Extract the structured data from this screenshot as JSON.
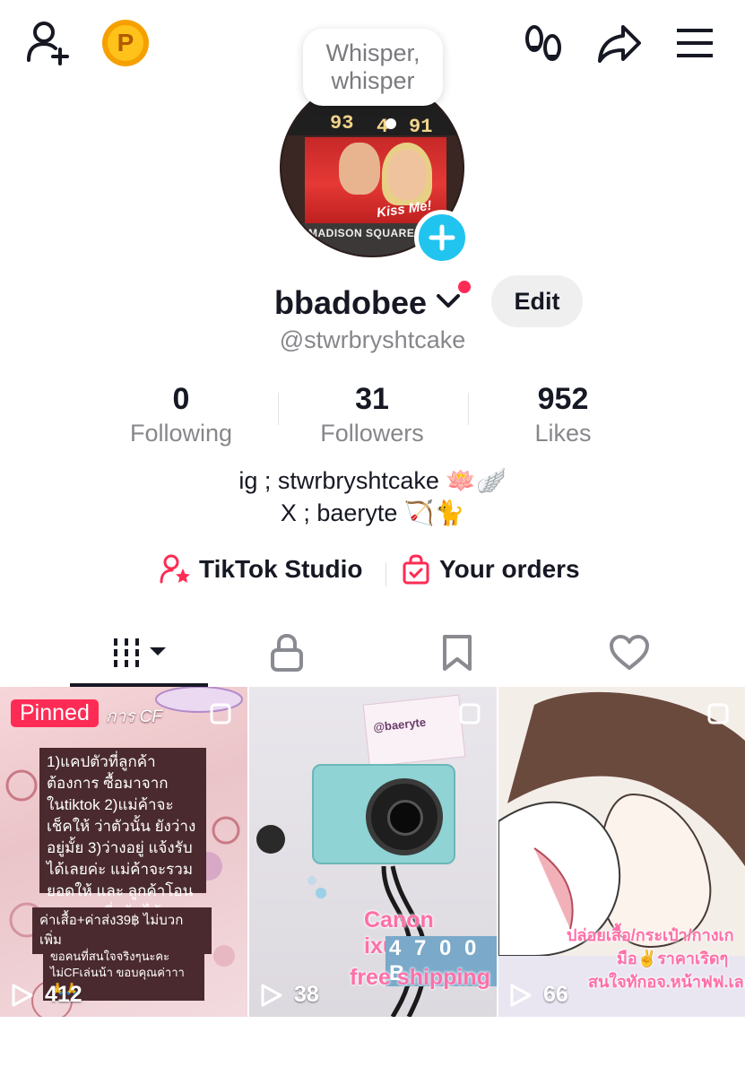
{
  "tooltip": {
    "text_line1": "Whisper,",
    "text_line2": "whisper"
  },
  "avatar": {
    "score_left": "93",
    "score_period": "4",
    "score_right": "91",
    "caption": "Kiss Me!",
    "sign": "MADISON SQUARE GA"
  },
  "profile": {
    "username": "bbadobee",
    "handle": "@stwrbryshtcake",
    "edit_label": "Edit"
  },
  "stats": [
    {
      "value": "0",
      "label": "Following"
    },
    {
      "value": "31",
      "label": "Followers"
    },
    {
      "value": "952",
      "label": "Likes"
    }
  ],
  "bio": {
    "line1": "ig ; stwrbryshtcake 🪷🪽",
    "line2": "X ; baeryte 🏹🐈"
  },
  "links": {
    "studio_label": "TikTok Studio",
    "orders_label": "Your orders"
  },
  "colors": {
    "accent": "#fe2c55",
    "add_button": "#20c4ef",
    "coin": "#f6a000"
  },
  "videos": [
    {
      "pinned_label": "Pinned",
      "header_text": "การ CF",
      "body_text": "1)แคปตัวที่ลูกค้าต้องการ ซื้อมาจาก ในtiktok 2)แม่ค้าจะเช็คให้ ว่าตัวนั้น ยังว่างอยู่มั้ย 3)ว่างอยู่ แจ้งรับได้เลยค่ะ แม่ค้าจะรวมยอดให้ และ ลูกค้าโอนยอดตามที่แจ้ง ได้เลยค่า",
      "shipping_text": "ค่าเสื้อ+ค่าส่ง39฿ ไม่บวกเพิ่ม",
      "thanks_text": "ขอคนที่สนใจจริงๆนะคะ ไม่CFเล่นน้า ขอบคุณค่าาา🙏🙏",
      "views": "412"
    },
    {
      "sticker_text": "@baeryte",
      "overlay_line1": "Canon ixus1",
      "overlay_line2": "4 7 0 0 B",
      "overlay_line3": "free shipping",
      "views": "38"
    },
    {
      "overlay_line1": "ปล่อยเสื้อ/กระเป๋า/กางเก",
      "overlay_line2": "มือ✌️ราคาเริดๆ",
      "overlay_line3": "สนใจทักอจ.หน้าฟฟ.เลยค่",
      "views": "66"
    }
  ]
}
